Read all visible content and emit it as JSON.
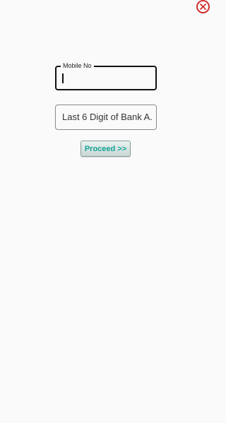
{
  "close": {
    "icon": "close-icon",
    "color": "#d32f2f"
  },
  "form": {
    "mobile": {
      "label": "Mobile No",
      "value": ""
    },
    "bank_digits": {
      "placeholder": "Last 6 Digit of Bank A..."
    },
    "proceed_label": "Proceed >>"
  },
  "colors": {
    "accent": "#14a394",
    "close": "#d32f2f",
    "background": "#fafafa"
  }
}
